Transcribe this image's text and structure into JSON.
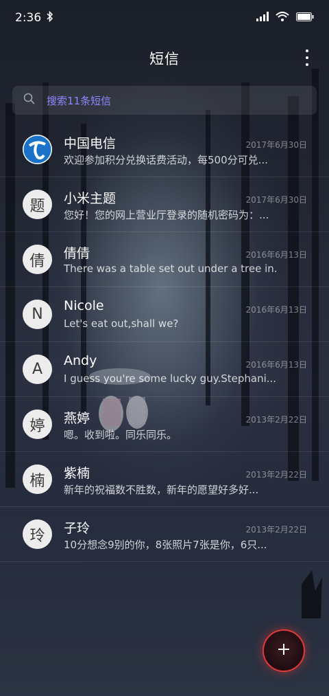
{
  "status_bar": {
    "time": "2:36",
    "icons": [
      "bluetooth-icon",
      "signal-icon",
      "wifi-icon",
      "battery-icon"
    ]
  },
  "appbar": {
    "title": "短信",
    "more_icon": "more-vertical-icon"
  },
  "search": {
    "placeholder": "搜索11条短信",
    "icon": "search-icon"
  },
  "conversations": [
    {
      "avatar": "",
      "avatar_icon": "china-telecom-logo",
      "name": "中国电信",
      "date": "2017年6月30日",
      "preview": "欢迎参加积分兑换话费活动，每500分可兑..."
    },
    {
      "avatar": "题",
      "name": "小米主题",
      "date": "2017年6月30日",
      "preview": "您好！您的网上营业厅登录的随机密码为：..."
    },
    {
      "avatar": "倩",
      "name": "倩倩",
      "date": "2016年6月13日",
      "preview": "There was a table set out under a tree in..."
    },
    {
      "avatar": "N",
      "name": "Nicole",
      "date": "2016年6月13日",
      "preview": "Let's eat out,shall we?"
    },
    {
      "avatar": "A",
      "name": "Andy",
      "date": "2016年6月13日",
      "preview": "I guess you're some lucky guy.Stephani..."
    },
    {
      "avatar": "婷",
      "name": "燕婷",
      "date": "2013年2月22日",
      "preview": "嗯。收到啦。同乐同乐。"
    },
    {
      "avatar": "楠",
      "name": "紫楠",
      "date": "2013年2月22日",
      "preview": "新年的祝福数不胜数，新年的愿望好多好..."
    },
    {
      "avatar": "玲",
      "name": "子玲",
      "date": "2013年2月22日",
      "preview": "10分想念9别的你，8张照片7张是你，6只..."
    }
  ],
  "fab": {
    "icon": "plus-icon"
  },
  "colors": {
    "accent": "#8f86ff",
    "fab_ring": "#e23a3a"
  }
}
